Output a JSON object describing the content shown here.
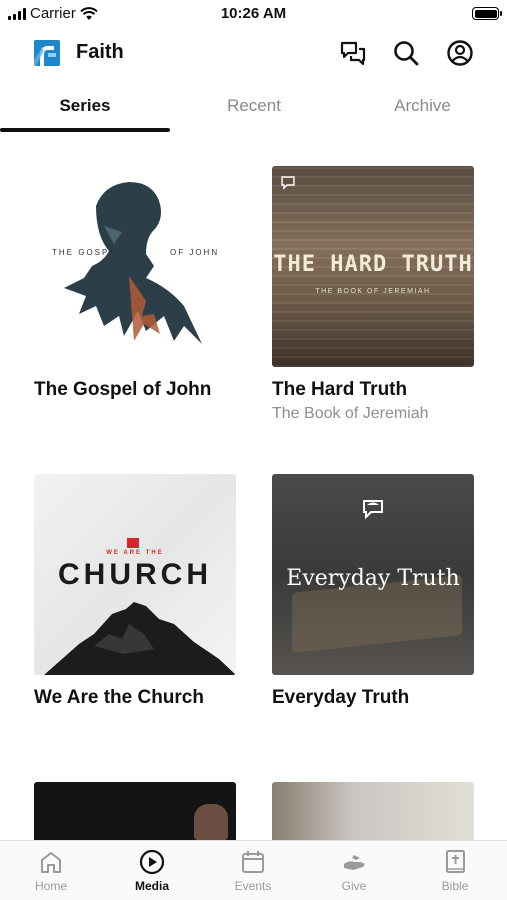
{
  "status_bar": {
    "carrier": "Carrier",
    "time": "10:26 AM"
  },
  "header": {
    "title": "Faith",
    "icons": [
      "messages-icon",
      "search-icon",
      "profile-icon"
    ]
  },
  "tabs": [
    {
      "label": "Series",
      "active": true
    },
    {
      "label": "Recent",
      "active": false
    },
    {
      "label": "Archive",
      "active": false
    }
  ],
  "series": [
    {
      "title": "The Gospel of John",
      "subtitle": "",
      "art_text_left": "THE GOSPEL",
      "art_text_right": "OF JOHN"
    },
    {
      "title": "The Hard Truth",
      "subtitle": "The Book of Jeremiah",
      "art_title": "THE HARD TRUTH",
      "art_sub": "THE BOOK OF JEREMIAH"
    },
    {
      "title": "We Are the Church",
      "subtitle": "",
      "art_small": "WE ARE THE",
      "art_title": "CHURCH"
    },
    {
      "title": "Everyday Truth",
      "subtitle": "",
      "art_title": "Everyday Truth"
    }
  ],
  "bottom_nav": [
    {
      "label": "Home",
      "icon": "home-icon",
      "active": false
    },
    {
      "label": "Media",
      "icon": "play-icon",
      "active": true
    },
    {
      "label": "Events",
      "icon": "calendar-icon",
      "active": false
    },
    {
      "label": "Give",
      "icon": "give-icon",
      "active": false
    },
    {
      "label": "Bible",
      "icon": "bible-icon",
      "active": false
    }
  ],
  "colors": {
    "accent": "#111111",
    "inactive": "#9a9a9a",
    "logo_blue": "#1f86c9"
  }
}
